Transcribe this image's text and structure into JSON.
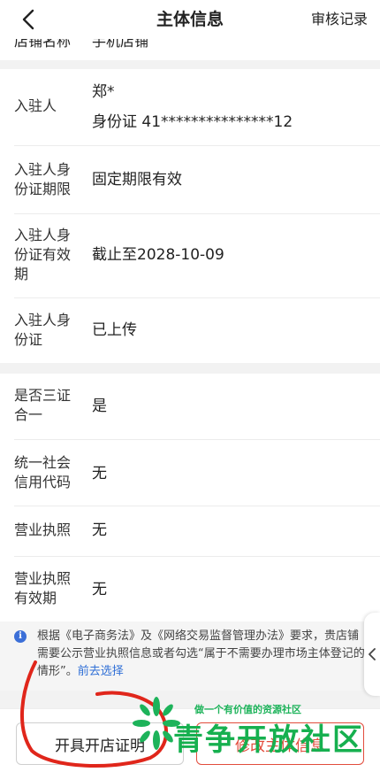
{
  "header": {
    "title": "主体信息",
    "audit_link": "审核记录"
  },
  "cut_row": {
    "label": "店铺名称",
    "value": "手机店铺"
  },
  "section1": {
    "rows": [
      {
        "label": "入驻人",
        "name": "郑*",
        "id_text": "身份证 41***************12"
      },
      {
        "label": "入驻人身份证期限",
        "value": "固定期限有效"
      },
      {
        "label": "入驻人身份证有效期",
        "value": "截止至2028-10-09"
      },
      {
        "label": "入驻人身份证",
        "value": "已上传"
      }
    ]
  },
  "section2": {
    "rows": [
      {
        "label": "是否三证合一",
        "value": "是"
      },
      {
        "label": "统一社会信用代码",
        "value": "无"
      },
      {
        "label": "营业执照",
        "value": "无"
      },
      {
        "label": "营业执照有效期",
        "value": "无"
      }
    ]
  },
  "notice": {
    "text": "根据《电子商务法》及《网络交易监督管理办法》要求，贵店铺需要公示营业执照信息或者勾选“属于不需要办理市场主体登记的情形”。",
    "link": "前去选择"
  },
  "bottom": {
    "certificate_button": "开具开店证明",
    "modify_button": "修改主体信息"
  },
  "watermark": {
    "slogan": "做一个有价值的资源社区",
    "name": "青争开放社区"
  },
  "colors": {
    "accent_blue": "#2f6fd6",
    "accent_red": "#e24c3c",
    "watermark_green": "#16b04f"
  }
}
